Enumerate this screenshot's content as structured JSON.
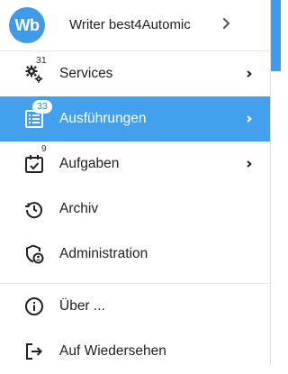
{
  "user": {
    "avatar_initials": "Wb",
    "name": "Writer best4Automic"
  },
  "colors": {
    "accent": "#3f9bea",
    "active_bg": "#42a0ec"
  },
  "menu": [
    {
      "label": "Services",
      "badge": "31",
      "icon": "gears-icon",
      "has_submenu": true,
      "active": false
    },
    {
      "label": "Ausführungen",
      "badge": "33",
      "icon": "list-icon",
      "has_submenu": true,
      "active": true
    },
    {
      "label": "Aufgaben",
      "badge": "9",
      "icon": "calendar-check-icon",
      "has_submenu": true,
      "active": false
    },
    {
      "label": "Archiv",
      "icon": "history-icon",
      "has_submenu": false,
      "active": false
    },
    {
      "label": "Administration",
      "icon": "shield-user-icon",
      "has_submenu": false,
      "active": false
    }
  ],
  "footer_menu": [
    {
      "label": "Über ...",
      "icon": "info-icon"
    },
    {
      "label": "Auf Wiedersehen",
      "icon": "logout-icon"
    }
  ]
}
